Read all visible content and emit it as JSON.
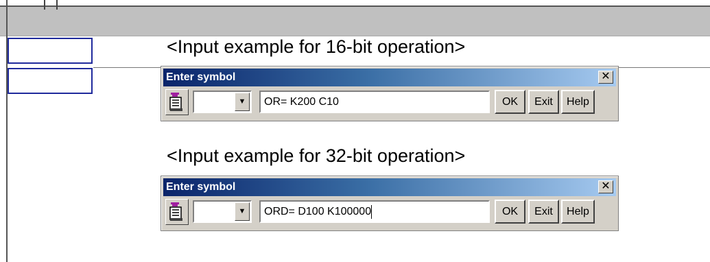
{
  "captions": {
    "example_16bit": "<Input example for 16-bit operation>",
    "example_32bit": "<Input example for 32-bit operation>"
  },
  "dialogs": [
    {
      "title": "Enter symbol",
      "close_glyph": "✕",
      "combo_value": "",
      "combo_arrow_glyph": "▼",
      "input_value": "OR= K200 C10",
      "ok_label": "OK",
      "exit_label": "Exit",
      "help_label": "Help"
    },
    {
      "title": "Enter symbol",
      "close_glyph": "✕",
      "combo_value": "",
      "combo_arrow_glyph": "▼",
      "input_value": "ORD= D100 K100000",
      "ok_label": "OK",
      "exit_label": "Exit",
      "help_label": "Help"
    }
  ],
  "icons": {
    "symbol_tool": "ladder-symbol-icon"
  },
  "colors": {
    "title_gradient_start": "#0a246a",
    "title_gradient_end": "#a6caf0",
    "cursor_border": "#1f2a9c",
    "dialog_face": "#d4d0c8",
    "ladder_band": "#c0c0c0"
  }
}
